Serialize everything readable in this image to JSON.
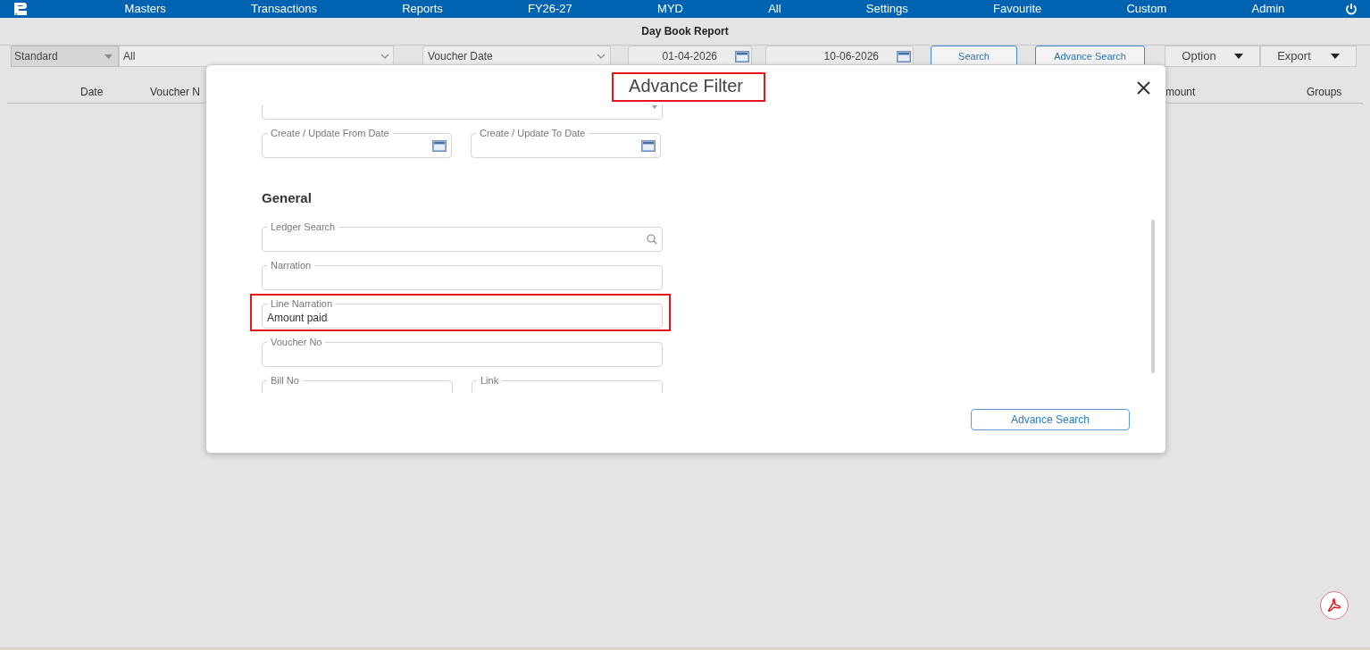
{
  "nav": {
    "items": [
      "Masters",
      "Transactions",
      "Reports",
      "FY26-27",
      "MYD",
      "All",
      "Settings",
      "Favourite",
      "Custom",
      "Admin"
    ]
  },
  "report_title": "Day Book Report",
  "toolbar": {
    "layout_select": "Standard",
    "filter_select": "All",
    "date_type_select": "Voucher Date",
    "from_date": "01-04-2026",
    "to_date": "10-06-2026",
    "search_button": "Search",
    "advance_search_button": "Advance Search",
    "option_button": "Option",
    "export_button": "Export"
  },
  "columns": [
    "Date",
    "Voucher N",
    "mount",
    "Groups"
  ],
  "modal": {
    "title": "Advance Filter",
    "title_highlighted": true,
    "sections": [
      {
        "rows": [
          [
            {
              "kind": "select",
              "highlighted": false
            }
          ],
          [
            {
              "kind": "date",
              "label": "Create / Update From Date",
              "highlighted": false
            },
            {
              "kind": "date",
              "label": "Create / Update To Date",
              "highlighted": false
            }
          ]
        ]
      },
      {
        "heading": "General",
        "rows": [
          [
            {
              "kind": "search",
              "label": "Ledger Search",
              "highlighted": false
            }
          ],
          [
            {
              "kind": "text",
              "label": "Narration",
              "highlighted": false
            }
          ],
          [
            {
              "kind": "text",
              "label": "Line Narration",
              "value": "Amount paid",
              "highlighted": true
            }
          ],
          [
            {
              "kind": "text",
              "label": "Voucher No",
              "highlighted": false
            }
          ],
          [
            {
              "kind": "text",
              "label": "Bill No",
              "highlighted": false
            },
            {
              "kind": "text",
              "label": "Link",
              "highlighted": false
            }
          ]
        ]
      }
    ],
    "button": "Advance Search"
  }
}
